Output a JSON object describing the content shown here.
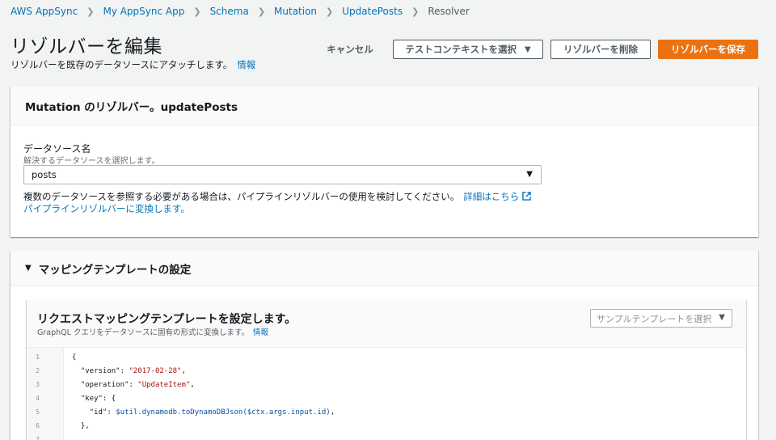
{
  "breadcrumb": [
    "AWS AppSync",
    "My AppSync App",
    "Schema",
    "Mutation",
    "UpdatePosts",
    "Resolver"
  ],
  "header": {
    "title": "リゾルバーを編集",
    "description": "リゾルバーを既存のデータソースにアタッチします。",
    "info_link": "情報"
  },
  "actions": {
    "cancel": "キャンセル",
    "test_context": "テストコンテキストを選択",
    "delete": "リゾルバーを削除",
    "save": "リゾルバーを保存"
  },
  "resolver_panel": {
    "title": "Mutation のリゾルバー。updatePosts",
    "datasource_label": "データソース名",
    "datasource_desc": "解決するデータソースを選択します。",
    "datasource_value": "posts",
    "pipeline_note": "複数のデータソースを参照する必要がある場合は、パイプラインリゾルバーの使用を検討してください。",
    "learn_more": "詳細はこちら",
    "convert_link": "パイプラインリゾルバーに変換します。"
  },
  "mapping_panel": {
    "title": "マッピングテンプレートの設定",
    "request": {
      "title": "リクエストマッピングテンプレートを設定します。",
      "description": "GraphQL クエリをデータソースに固有の形式に変換します。",
      "info_link": "情報",
      "sample_placeholder": "サンプルテンプレートを選択"
    },
    "code_lines": [
      {
        "n": "1",
        "text": "{"
      },
      {
        "n": "2",
        "text": "  \"version\": \"2017-02-28\","
      },
      {
        "n": "3",
        "text": "  \"operation\": \"UpdateItem\","
      },
      {
        "n": "4",
        "text": "  \"key\": {"
      },
      {
        "n": "5",
        "text": "    \"id\": $util.dynamodb.toDynamoDBJson($ctx.args.input.id),"
      },
      {
        "n": "6",
        "text": "  },"
      },
      {
        "n": "7",
        "text": ""
      }
    ]
  },
  "colors": {
    "accent": "#ec7211",
    "link": "#0073bb",
    "background": "#f2f3f3"
  }
}
